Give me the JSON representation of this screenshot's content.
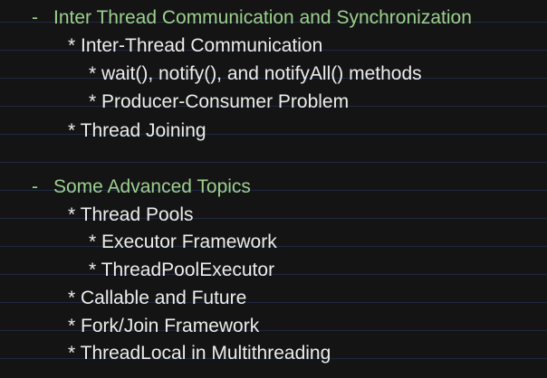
{
  "sections": [
    {
      "marker": "-",
      "title": "Inter Thread Communication and Synchronization",
      "items": [
        {
          "text": "* Inter-Thread Communication"
        },
        {
          "text": "* wait(), notify(), and notifyAll() methods"
        },
        {
          "text": "* Producer-Consumer Problem"
        },
        {
          "text": "* Thread Joining"
        }
      ]
    },
    {
      "marker": "-",
      "title": "Some Advanced Topics",
      "items": [
        {
          "text": "* Thread Pools"
        },
        {
          "text": "* Executor Framework"
        },
        {
          "text": "* ThreadPoolExecutor"
        },
        {
          "text": "* Callable and Future"
        },
        {
          "text": "* Fork/Join Framework"
        },
        {
          "text": "* ThreadLocal in Multithreading"
        }
      ]
    }
  ],
  "colors": {
    "background": "#141414",
    "section_heading": "#9ccf8f",
    "body_text": "#ececec",
    "rule_lines": "#1f2940"
  }
}
